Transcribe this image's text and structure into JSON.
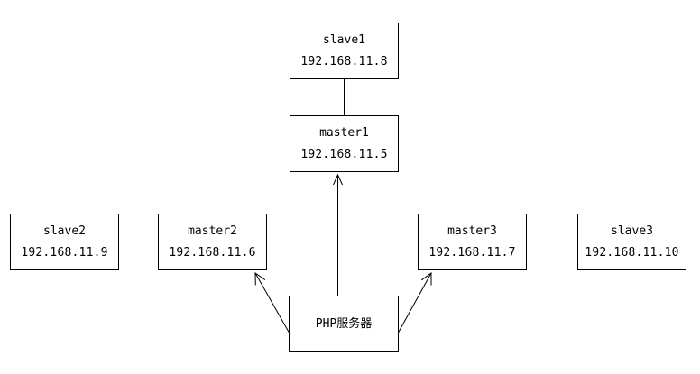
{
  "diagram": {
    "nodes": {
      "slave1": {
        "name": "slave1",
        "ip": "192.168.11.8"
      },
      "master1": {
        "name": "master1",
        "ip": "192.168.11.5"
      },
      "slave2": {
        "name": "slave2",
        "ip": "192.168.11.9"
      },
      "master2": {
        "name": "master2",
        "ip": "192.168.11.6"
      },
      "master3": {
        "name": "master3",
        "ip": "192.168.11.7"
      },
      "slave3": {
        "name": "slave3",
        "ip": "192.168.11.10"
      },
      "php": {
        "label": "PHP服务器"
      }
    },
    "edges": [
      {
        "from": "master1",
        "to": "slave1",
        "style": "line"
      },
      {
        "from": "slave2",
        "to": "master2",
        "style": "line"
      },
      {
        "from": "master3",
        "to": "slave3",
        "style": "line"
      },
      {
        "from": "php",
        "to": "master1",
        "style": "arrow"
      },
      {
        "from": "php",
        "to": "master2",
        "style": "arrow"
      },
      {
        "from": "php",
        "to": "master3",
        "style": "arrow"
      }
    ],
    "stroke_color": "#000000"
  }
}
